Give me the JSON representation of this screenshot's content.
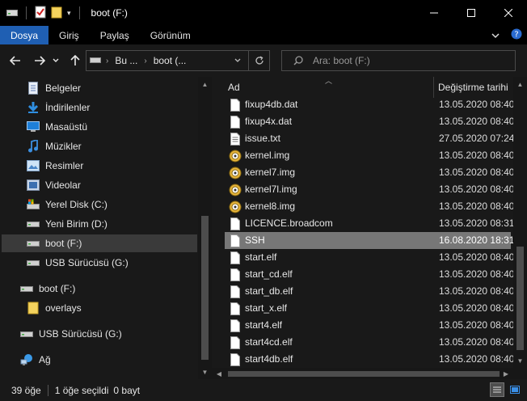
{
  "window": {
    "title": "boot (F:)",
    "colors": {
      "titlebar": "#000000",
      "accent": "#1f5fb3",
      "background": "#191919",
      "selected_row": "#777777"
    }
  },
  "ribbon": {
    "tabs": [
      {
        "label": "Dosya",
        "active": true
      },
      {
        "label": "Giriş",
        "active": false
      },
      {
        "label": "Paylaş",
        "active": false
      },
      {
        "label": "Görünüm",
        "active": false
      }
    ]
  },
  "address": {
    "segments": [
      "Bu ...",
      "boot (..."
    ],
    "search_placeholder": "Ara: boot (F:)"
  },
  "nav": {
    "items": [
      {
        "label": "Belgeler",
        "icon": "document-icon",
        "selected": false
      },
      {
        "label": "İndirilenler",
        "icon": "download-icon",
        "selected": false
      },
      {
        "label": "Masaüstü",
        "icon": "desktop-icon",
        "selected": false
      },
      {
        "label": "Müzikler",
        "icon": "music-icon",
        "selected": false
      },
      {
        "label": "Resimler",
        "icon": "pictures-icon",
        "selected": false
      },
      {
        "label": "Videolar",
        "icon": "video-icon",
        "selected": false
      },
      {
        "label": "Yerel Disk (C:)",
        "icon": "system-drive-icon",
        "selected": false
      },
      {
        "label": "Yeni Birim (D:)",
        "icon": "drive-icon",
        "selected": false
      },
      {
        "label": "boot (F:)",
        "icon": "drive-icon",
        "selected": true
      },
      {
        "label": "USB Sürücüsü (G:)",
        "icon": "drive-icon",
        "selected": false
      },
      {
        "label": "boot (F:)",
        "icon": "drive-icon",
        "selected": false
      },
      {
        "label": "overlays",
        "icon": "folder-icon",
        "selected": false
      },
      {
        "label": "USB Sürücüsü (G:)",
        "icon": "drive-icon",
        "selected": false
      },
      {
        "label": "Ağ",
        "icon": "network-icon",
        "selected": false
      }
    ]
  },
  "files": {
    "columns": {
      "name": "Ad",
      "date": "Değiştirme tarihi"
    },
    "rows": [
      {
        "name": "fixup4db.dat",
        "date": "13.05.2020 08:40",
        "icon": "file-icon",
        "selected": false
      },
      {
        "name": "fixup4x.dat",
        "date": "13.05.2020 08:40",
        "icon": "file-icon",
        "selected": false
      },
      {
        "name": "issue.txt",
        "date": "27.05.2020 07:24",
        "icon": "text-file-icon",
        "selected": false
      },
      {
        "name": "kernel.img",
        "date": "13.05.2020 08:40",
        "icon": "disc-image-icon",
        "selected": false
      },
      {
        "name": "kernel7.img",
        "date": "13.05.2020 08:40",
        "icon": "disc-image-icon",
        "selected": false
      },
      {
        "name": "kernel7l.img",
        "date": "13.05.2020 08:40",
        "icon": "disc-image-icon",
        "selected": false
      },
      {
        "name": "kernel8.img",
        "date": "13.05.2020 08:40",
        "icon": "disc-image-icon",
        "selected": false
      },
      {
        "name": "LICENCE.broadcom",
        "date": "13.05.2020 08:31",
        "icon": "file-icon",
        "selected": false
      },
      {
        "name": "SSH",
        "date": "16.08.2020 18:31",
        "icon": "file-icon",
        "selected": true
      },
      {
        "name": "start.elf",
        "date": "13.05.2020 08:40",
        "icon": "file-icon",
        "selected": false
      },
      {
        "name": "start_cd.elf",
        "date": "13.05.2020 08:40",
        "icon": "file-icon",
        "selected": false
      },
      {
        "name": "start_db.elf",
        "date": "13.05.2020 08:40",
        "icon": "file-icon",
        "selected": false
      },
      {
        "name": "start_x.elf",
        "date": "13.05.2020 08:40",
        "icon": "file-icon",
        "selected": false
      },
      {
        "name": "start4.elf",
        "date": "13.05.2020 08:40",
        "icon": "file-icon",
        "selected": false
      },
      {
        "name": "start4cd.elf",
        "date": "13.05.2020 08:40",
        "icon": "file-icon",
        "selected": false
      },
      {
        "name": "start4db.elf",
        "date": "13.05.2020 08:40",
        "icon": "file-icon",
        "selected": false
      }
    ]
  },
  "status": {
    "item_count": "39 öğe",
    "selection": "1 öğe seçildi",
    "size": "0 bayt"
  }
}
